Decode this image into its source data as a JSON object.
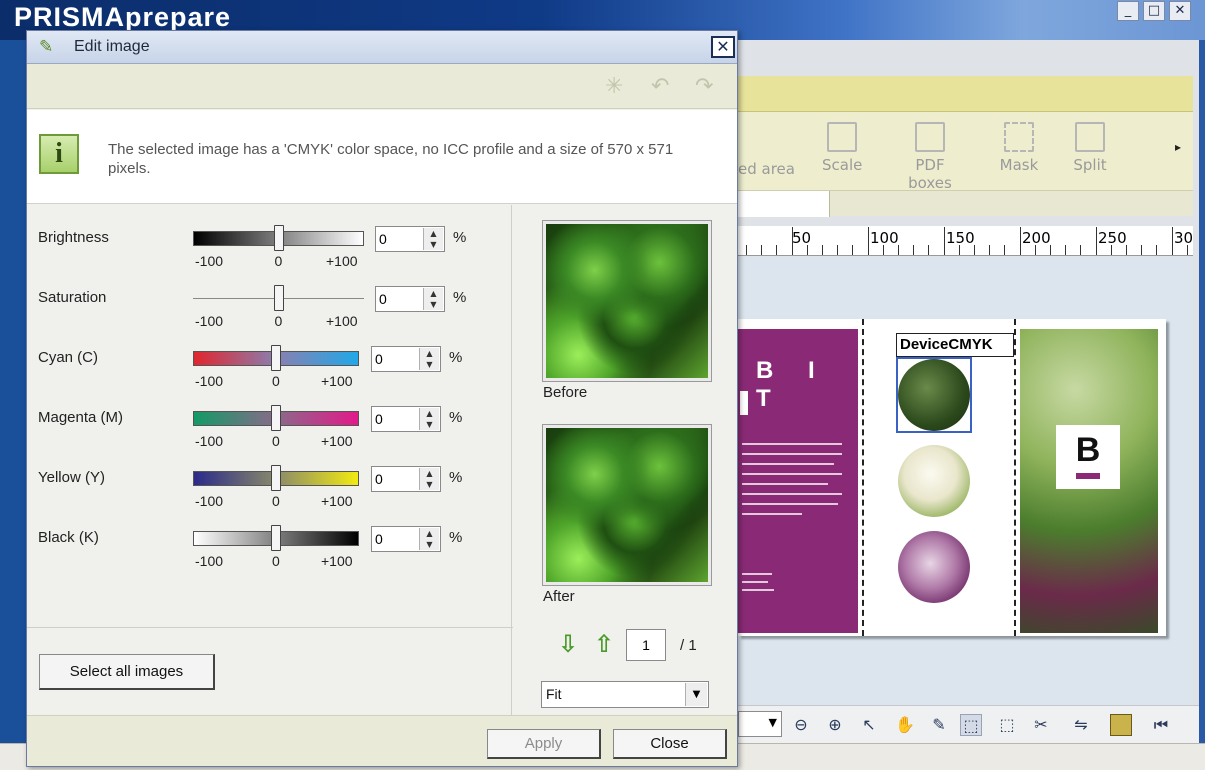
{
  "app": {
    "title": "PRISMAprepare",
    "window_controls": [
      "_",
      "□",
      "✕"
    ]
  },
  "ribbon": {
    "partial_label": "ed area",
    "buttons": [
      {
        "label": "Scale",
        "icon": "scale-icon"
      },
      {
        "label": "PDF boxes",
        "icon": "pdf-boxes-icon"
      },
      {
        "label": "Mask",
        "icon": "mask-icon"
      },
      {
        "label": "Split",
        "icon": "split-icon"
      }
    ],
    "more_arrow": "▸"
  },
  "ruler": {
    "labels": [
      "50",
      "100",
      "150",
      "200",
      "250",
      "30"
    ]
  },
  "document_preview": {
    "purple_heading": "B I T",
    "device_label": "DeviceCMYK",
    "poster_logo": "B"
  },
  "dialog": {
    "title": "Edit image",
    "close_symbol": "✕",
    "info_text": "The selected image has a 'CMYK' color space, no ICC profile and a size of 570 x 571 pixels.",
    "info_icon_text": "i",
    "adjustments": [
      {
        "label": "Brightness",
        "value": "0",
        "unit": "%",
        "min_label": "-100",
        "mid_label": "0",
        "max_label": "+100",
        "level": 0.5
      },
      {
        "label": "Saturation",
        "value": "0",
        "unit": "%",
        "min_label": "-100",
        "mid_label": "0",
        "max_label": "+100",
        "level": 0.5
      },
      {
        "label": "Cyan (C)",
        "value": "0",
        "unit": "%",
        "min_label": "-100",
        "mid_label": "0",
        "max_label": "+100",
        "level": 0.5
      },
      {
        "label": "Magenta (M)",
        "value": "0",
        "unit": "%",
        "min_label": "-100",
        "mid_label": "0",
        "max_label": "+100",
        "level": 0.5
      },
      {
        "label": "Yellow (Y)",
        "value": "0",
        "unit": "%",
        "min_label": "-100",
        "mid_label": "0",
        "max_label": "+100",
        "level": 0.5
      },
      {
        "label": "Black (K)",
        "value": "0",
        "unit": "%",
        "min_label": "-100",
        "mid_label": "0",
        "max_label": "+100",
        "level": 0.5
      }
    ],
    "select_all_label": "Select all images",
    "preview": {
      "before_label": "Before",
      "after_label": "After",
      "page_value": "1",
      "page_total": "/ 1",
      "zoom_option": "Fit"
    },
    "apply_label": "Apply",
    "close_label": "Close"
  }
}
